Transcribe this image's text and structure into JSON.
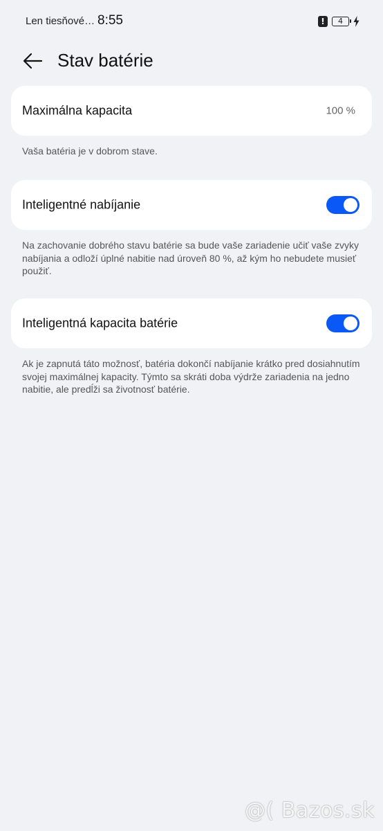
{
  "status_bar": {
    "carrier": "Len tiesňové…",
    "time": "8:55",
    "battery_level": "4"
  },
  "header": {
    "title": "Stav batérie"
  },
  "max_capacity": {
    "label": "Maximálna kapacita",
    "value": "100 %",
    "description": "Vaša batéria je v dobrom stave."
  },
  "smart_charging": {
    "label": "Inteligentné nabíjanie",
    "enabled": true,
    "description": "Na zachovanie dobrého stavu batérie sa bude vaše zariadenie učiť vaše zvyky nabíjania a odloží úplné nabitie nad úroveň 80 %, až kým ho nebudete musieť použiť."
  },
  "smart_capacity": {
    "label": "Inteligentná kapacita batérie",
    "enabled": true,
    "description": "Ak je zapnutá táto možnosť, batéria dokončí nabíjanie krátko pred dosiahnutím svojej maximálnej kapacity. Týmto sa skráti doba výdrže zariadenia na jedno nabitie, ale predĺži sa životnosť batérie."
  },
  "watermark": "@( Bazos.sk",
  "colors": {
    "background": "#f1f2f5",
    "accent": "#0a59f7",
    "card": "#ffffff"
  }
}
